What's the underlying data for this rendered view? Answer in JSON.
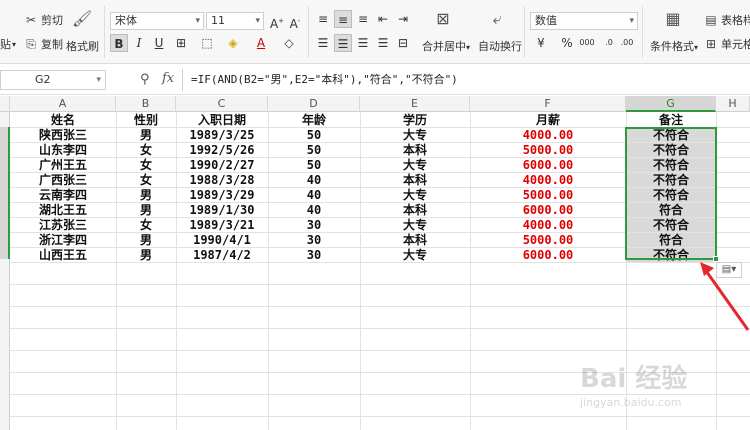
{
  "ribbon": {
    "cut_label": "剪切",
    "copy_label": "复制",
    "paste_label": "贴",
    "format_painter_label": "格式刷",
    "font_name": "宋体",
    "font_size": "11",
    "merge_center_label": "合并居中",
    "wrap_text_label": "自动换行",
    "number_format": "数值",
    "cond_format_label": "条件格式",
    "table_style_label": "表格样",
    "cell_style_label": "单元格"
  },
  "formula_bar": {
    "name_box": "G2",
    "fx_label": "fx",
    "formula": "=IF(AND(B2=\"男\",E2=\"本科\"),\"符合\",\"不符合\")"
  },
  "columns": [
    "A",
    "B",
    "C",
    "D",
    "E",
    "F",
    "G",
    "H"
  ],
  "selected_column": "G",
  "table": {
    "headers": [
      "姓名",
      "性别",
      "入职日期",
      "年龄",
      "学历",
      "月薪",
      "备注"
    ],
    "rows": [
      {
        "name": "陕西张三",
        "sex": "男",
        "date": "1989/3/25",
        "age": "50",
        "edu": "大专",
        "salary": "4000.00",
        "note": "不符合"
      },
      {
        "name": "山东李四",
        "sex": "女",
        "date": "1992/5/26",
        "age": "50",
        "edu": "本科",
        "salary": "5000.00",
        "note": "不符合"
      },
      {
        "name": "广州王五",
        "sex": "女",
        "date": "1990/2/27",
        "age": "50",
        "edu": "大专",
        "salary": "6000.00",
        "note": "不符合"
      },
      {
        "name": "广西张三",
        "sex": "女",
        "date": "1988/3/28",
        "age": "40",
        "edu": "本科",
        "salary": "4000.00",
        "note": "不符合"
      },
      {
        "name": "云南李四",
        "sex": "男",
        "date": "1989/3/29",
        "age": "40",
        "edu": "大专",
        "salary": "5000.00",
        "note": "不符合"
      },
      {
        "name": "湖北王五",
        "sex": "男",
        "date": "1989/1/30",
        "age": "40",
        "edu": "本科",
        "salary": "6000.00",
        "note": "符合"
      },
      {
        "name": "江苏张三",
        "sex": "女",
        "date": "1989/3/21",
        "age": "30",
        "edu": "大专",
        "salary": "4000.00",
        "note": "不符合"
      },
      {
        "name": "浙江李四",
        "sex": "男",
        "date": "1990/4/1",
        "age": "30",
        "edu": "本科",
        "salary": "5000.00",
        "note": "符合"
      },
      {
        "name": "山西王五",
        "sex": "男",
        "date": "1987/4/2",
        "age": "30",
        "edu": "大专",
        "salary": "6000.00",
        "note": "不符合"
      }
    ]
  },
  "watermark": {
    "text": "Bai 经验",
    "sub": "jingyan.baidu.com"
  },
  "colors": {
    "selection": "#2e9a3e",
    "salary": "#e00000",
    "selected_fill": "#d9d9d9"
  }
}
